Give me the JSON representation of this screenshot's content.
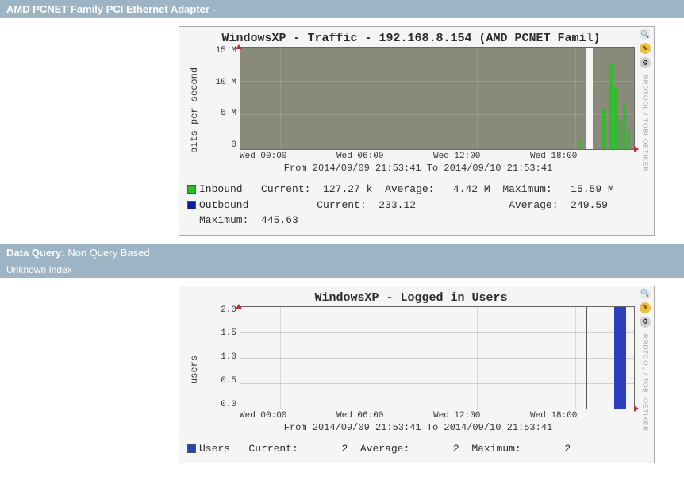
{
  "header1": "AMD PCNET Family PCI Ethernet Adapter -",
  "header2_label": "Data Query:",
  "header2_value": "Non Query Based",
  "header3": "Unknown Index",
  "chart1": {
    "title": "WindowsXP - Traffic - 192.168.8.154 (AMD PCNET Famil)",
    "ylabel": "bits per second",
    "yticks": [
      "15 M",
      "10 M",
      "5 M",
      "0"
    ],
    "xticks": [
      "Wed 00:00",
      "Wed 06:00",
      "Wed 12:00",
      "Wed 18:00"
    ],
    "range": "From 2014/09/09 21:53:41 To 2014/09/10 21:53:41",
    "legend": {
      "inbound_label": "Inbound",
      "outbound_label": "Outbound",
      "current_label": "Current:",
      "average_label": "Average:",
      "maximum_label": "Maximum:",
      "in_current": "127.27 k",
      "in_avg": "4.42 M",
      "in_max": "15.59 M",
      "out_current": "233.12",
      "out_avg": "249.59",
      "out_max": "445.63"
    },
    "tool_text": "RRDTOOL / TOBI OETIKER"
  },
  "chart2": {
    "title": "WindowsXP - Logged in Users",
    "ylabel": "users",
    "yticks": [
      "2.0",
      "1.5",
      "1.0",
      "0.5",
      "0.0"
    ],
    "xticks": [
      "Wed 00:00",
      "Wed 06:00",
      "Wed 12:00",
      "Wed 18:00"
    ],
    "range": "From 2014/09/09 21:53:41 To 2014/09/10 21:53:41",
    "legend": {
      "users_label": "Users",
      "current_label": "Current:",
      "average_label": "Average:",
      "maximum_label": "Maximum:",
      "current": "2",
      "avg": "2",
      "max": "2"
    },
    "tool_text": "RRDTOOL / TOBI OETIKER"
  },
  "chart_data": [
    {
      "type": "area",
      "title": "WindowsXP - Traffic - 192.168.8.154 (AMD PCNET Famil)",
      "xlabel": "",
      "ylabel": "bits per second",
      "ylim": [
        0,
        16000000
      ],
      "x_range": [
        "2014-09-09 21:53:41",
        "2014-09-10 21:53:41"
      ],
      "series": [
        {
          "name": "Inbound",
          "color": "#2dbd2d",
          "current": 127270,
          "average": 4420000,
          "maximum": 15590000
        },
        {
          "name": "Outbound",
          "color": "#0b1f9b",
          "current": 233.12,
          "average": 249.59,
          "maximum": 445.63
        }
      ],
      "xticks": [
        "Wed 00:00",
        "Wed 06:00",
        "Wed 12:00",
        "Wed 18:00"
      ]
    },
    {
      "type": "area",
      "title": "WindowsXP - Logged in Users",
      "xlabel": "",
      "ylabel": "users",
      "ylim": [
        0,
        2.0
      ],
      "x_range": [
        "2014-09-09 21:53:41",
        "2014-09-10 21:53:41"
      ],
      "series": [
        {
          "name": "Users",
          "color": "#2c3fbf",
          "current": 2,
          "average": 2,
          "maximum": 2
        }
      ],
      "xticks": [
        "Wed 00:00",
        "Wed 06:00",
        "Wed 12:00",
        "Wed 18:00"
      ]
    }
  ]
}
